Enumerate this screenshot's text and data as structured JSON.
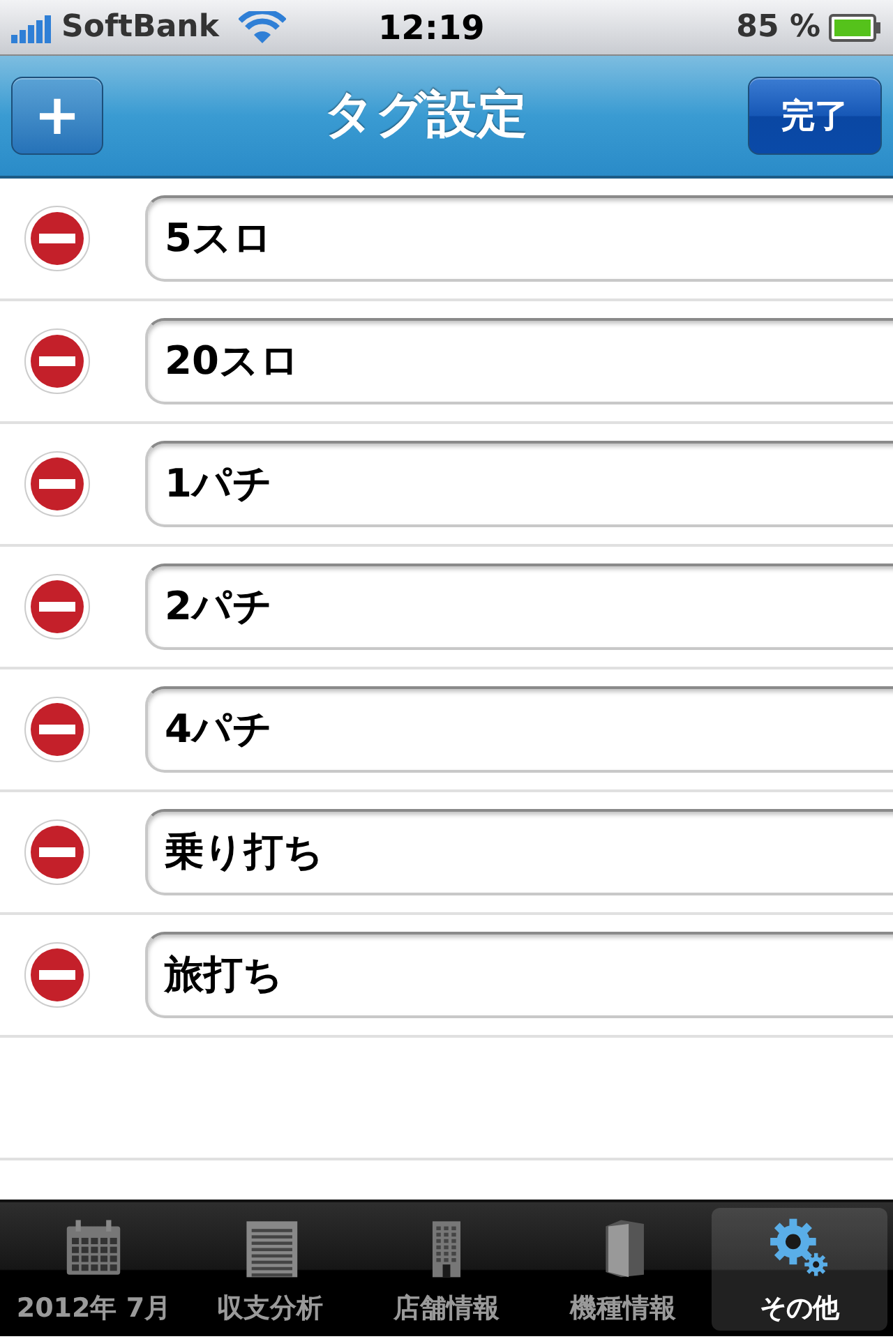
{
  "status_bar": {
    "carrier": "SoftBank",
    "time": "12:19",
    "battery": "85 %"
  },
  "nav_bar": {
    "title": "タグ設定",
    "left_button": "+",
    "right_button": "完了"
  },
  "tags": [
    {
      "value": "5スロ"
    },
    {
      "value": "20スロ"
    },
    {
      "value": "1パチ"
    },
    {
      "value": "2パチ"
    },
    {
      "value": "4パチ"
    },
    {
      "value": "乗り打ち"
    },
    {
      "value": "旅打ち"
    }
  ],
  "tab_bar": [
    {
      "label": "2012年 7月",
      "kind": "calendar",
      "selected": false
    },
    {
      "label": "収支分析",
      "kind": "notepad",
      "selected": false
    },
    {
      "label": "店舗情報",
      "kind": "building",
      "selected": false
    },
    {
      "label": "機種情報",
      "kind": "book",
      "selected": false
    },
    {
      "label": "その他",
      "kind": "gears",
      "selected": true
    }
  ]
}
